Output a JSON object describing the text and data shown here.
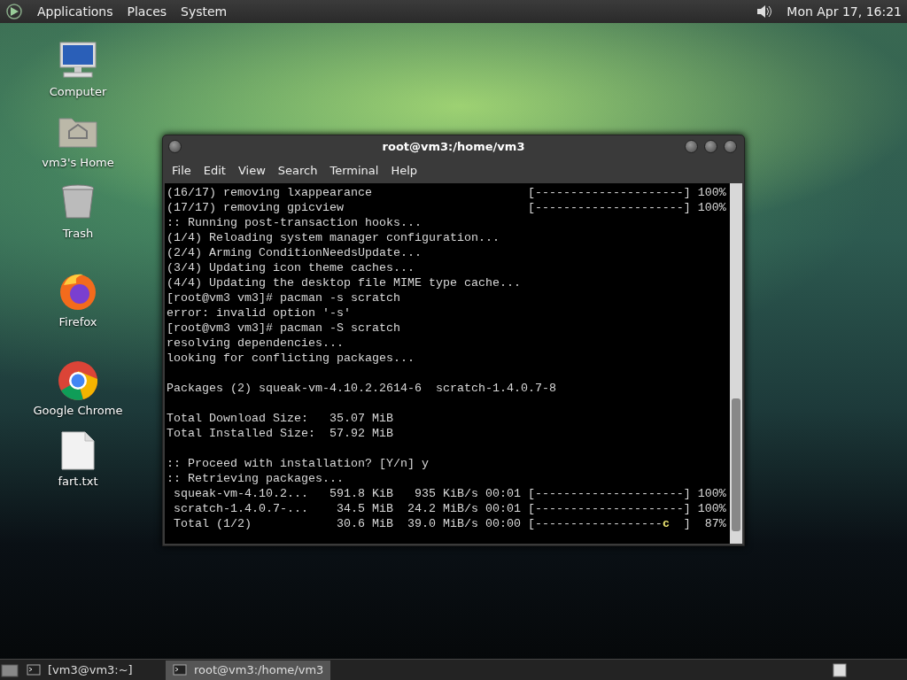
{
  "top_panel": {
    "menus": [
      "Applications",
      "Places",
      "System"
    ],
    "clock": "Mon Apr 17, 16:21"
  },
  "desktop_icons": [
    {
      "kind": "computer",
      "label": "Computer"
    },
    {
      "kind": "home",
      "label": "vm3's Home"
    },
    {
      "kind": "trash",
      "label": "Trash"
    },
    {
      "kind": "firefox",
      "label": "Firefox"
    },
    {
      "kind": "chrome",
      "label": "Google Chrome"
    },
    {
      "kind": "file",
      "label": "fart.txt"
    }
  ],
  "terminal": {
    "title": "root@vm3:/home/vm3",
    "menu": [
      "File",
      "Edit",
      "View",
      "Search",
      "Terminal",
      "Help"
    ],
    "blocks": [
      [
        {
          "text": "(16/17) removing lxappearance                      [---------------------] 100%"
        },
        {
          "text": "(17/17) removing gpicview                          [---------------------] 100%"
        },
        {
          "text": ":: Running post-transaction hooks..."
        },
        {
          "text": "(1/4) Reloading system manager configuration..."
        },
        {
          "text": "(2/4) Arming ConditionNeedsUpdate..."
        },
        {
          "text": "(3/4) Updating icon theme caches..."
        },
        {
          "text": "(4/4) Updating the desktop file MIME type cache..."
        },
        {
          "text": "[root@vm3 vm3]# pacman -s scratch"
        },
        {
          "text": "error: invalid option '-s'"
        },
        {
          "text": "[root@vm3 vm3]# pacman -S scratch"
        },
        {
          "text": "resolving dependencies..."
        },
        {
          "text": "looking for conflicting packages..."
        }
      ],
      [
        {
          "text": "Packages (2) squeak-vm-4.10.2.2614-6  scratch-1.4.0.7-8"
        }
      ],
      [
        {
          "text": "Total Download Size:   35.07 MiB"
        },
        {
          "text": "Total Installed Size:  57.92 MiB"
        }
      ],
      [
        {
          "text": ":: Proceed with installation? [Y/n] y"
        },
        {
          "text": ":: Retrieving packages..."
        },
        {
          "text": " squeak-vm-4.10.2...   591.8 KiB   935 KiB/s 00:01 [---------------------] 100%"
        },
        {
          "text": " scratch-1.4.0.7-...    34.5 MiB  24.2 MiB/s 00:01 [---------------------] 100%"
        },
        {
          "parts": [
            {
              "kind": "plain",
              "text": " Total (1/2)            30.6 MiB  39.0 MiB/s 00:00 [------------------"
            },
            {
              "kind": "pacman",
              "text": "c"
            },
            {
              "kind": "plain",
              "text": "  ]  87%"
            }
          ]
        }
      ]
    ]
  },
  "taskbar": {
    "items": [
      {
        "label": "[vm3@vm3:~]",
        "selected": false
      },
      {
        "label": "root@vm3:/home/vm3",
        "selected": true
      }
    ]
  }
}
